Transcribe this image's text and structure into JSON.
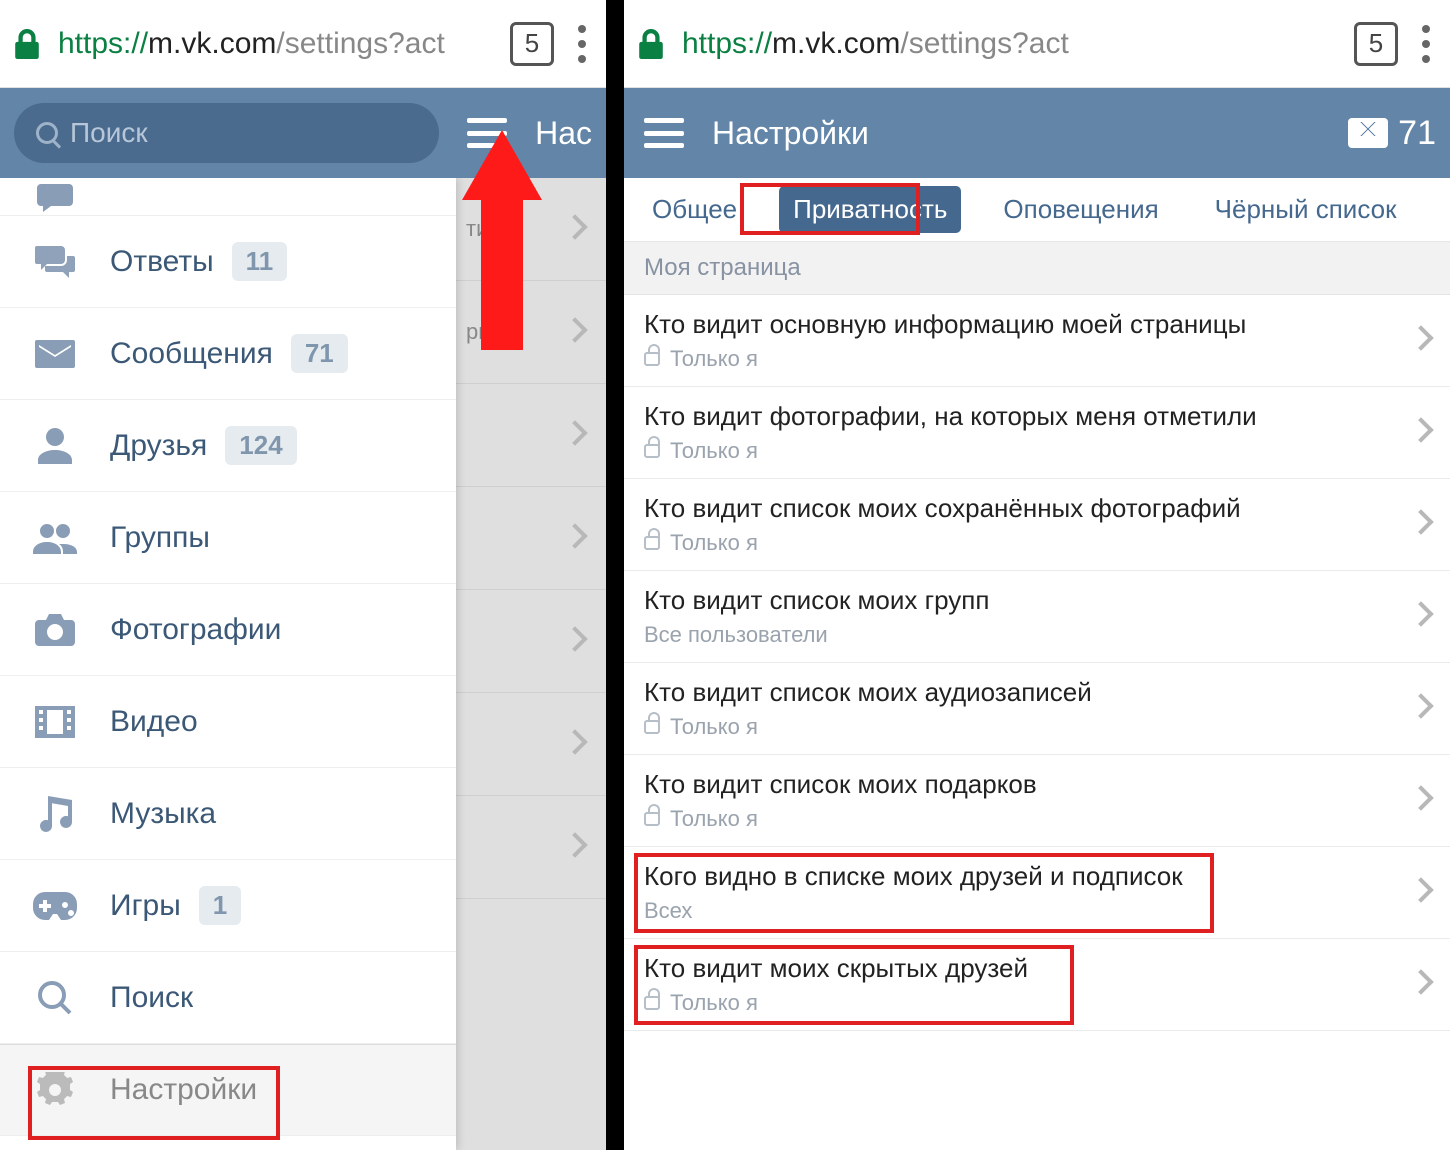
{
  "browser": {
    "scheme": "https://",
    "host": "m.vk.com",
    "path": "/settings?act",
    "tab_count": "5"
  },
  "left": {
    "search_placeholder": "Поиск",
    "header_title_cut": "Нас",
    "bg_row_labels": [
      "тил",
      "ри"
    ],
    "sidebar": [
      {
        "icon": "reply",
        "label": "Ответы",
        "badge": "11"
      },
      {
        "icon": "mail",
        "label": "Сообщения",
        "badge": "71"
      },
      {
        "icon": "friends",
        "label": "Друзья",
        "badge": "124"
      },
      {
        "icon": "groups",
        "label": "Группы",
        "badge": null
      },
      {
        "icon": "photos",
        "label": "Фотографии",
        "badge": null
      },
      {
        "icon": "video",
        "label": "Видео",
        "badge": null
      },
      {
        "icon": "music",
        "label": "Музыка",
        "badge": null
      },
      {
        "icon": "games",
        "label": "Игры",
        "badge": "1"
      },
      {
        "icon": "search",
        "label": "Поиск",
        "badge": null
      }
    ],
    "settings_label": "Настройки"
  },
  "right": {
    "header_title": "Настройки",
    "msg_count": "71",
    "tabs": [
      "Общее",
      "Приватность",
      "Оповещения",
      "Чёрный список"
    ],
    "active_tab": "Приватность",
    "section_header": "Моя страница",
    "items": [
      {
        "title": "Кто видит основную информацию моей страницы",
        "value": "Только я",
        "locked": true
      },
      {
        "title": "Кто видит фотографии, на которых меня отметили",
        "value": "Только я",
        "locked": true
      },
      {
        "title": "Кто видит список моих сохранённых фотографий",
        "value": "Только я",
        "locked": true
      },
      {
        "title": "Кто видит список моих групп",
        "value": "Все пользователи",
        "locked": false
      },
      {
        "title": "Кто видит список моих аудиозаписей",
        "value": "Только я",
        "locked": true
      },
      {
        "title": "Кто видит список моих подарков",
        "value": "Только я",
        "locked": true
      },
      {
        "title": "Кого видно в списке моих друзей и подписок",
        "value": "Всех",
        "locked": false
      },
      {
        "title": "Кто видит моих скрытых друзей",
        "value": "Только я",
        "locked": true
      }
    ]
  }
}
